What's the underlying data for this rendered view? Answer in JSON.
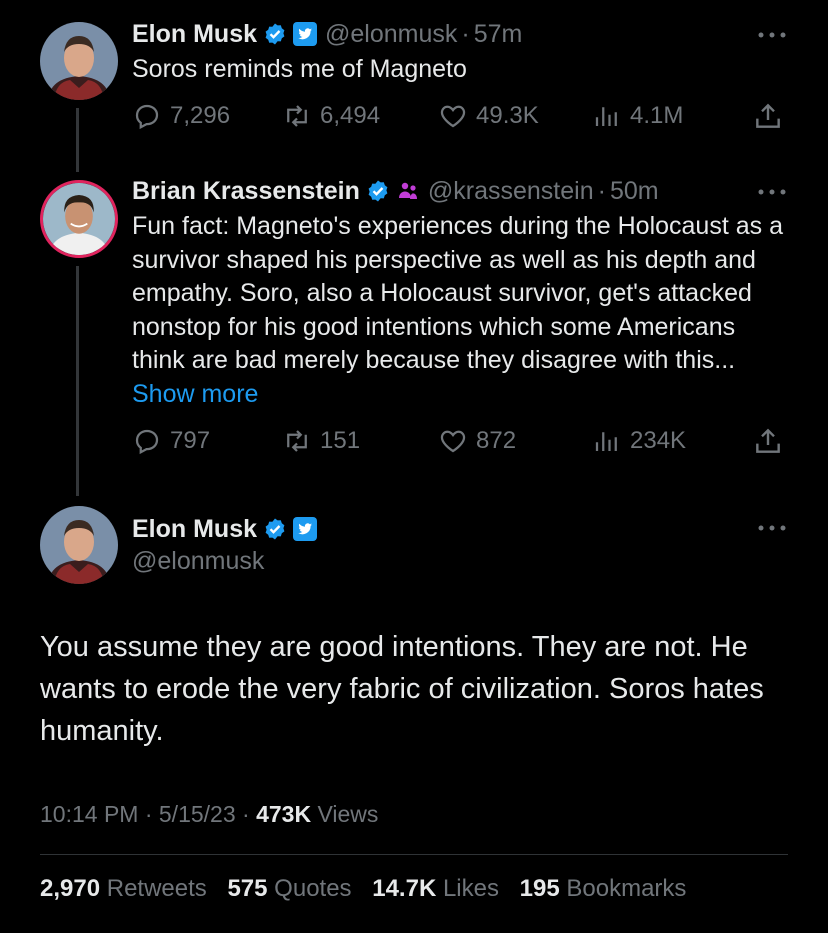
{
  "tweets": [
    {
      "name": "Elon Musk",
      "handle": "@elonmusk",
      "separator": "·",
      "time": "57m",
      "text": "Soros reminds me of Magneto",
      "replies": "7,296",
      "retweets": "6,494",
      "likes": "49.3K",
      "views": "4.1M"
    },
    {
      "name": "Brian Krassenstein",
      "handle": "@krassenstein",
      "separator": "·",
      "time": "50m",
      "text": "Fun fact:  Magneto's experiences during the Holocaust as a survivor shaped his perspective as well as his depth and empathy.  Soro, also a Holocaust survivor, get's attacked nonstop for his good intentions which some Americans think are bad merely because they disagree with this...",
      "show_more": "Show more",
      "replies": "797",
      "retweets": "151",
      "likes": "872",
      "views": "234K"
    }
  ],
  "main": {
    "name": "Elon Musk",
    "handle": "@elonmusk",
    "text": "You assume they are good intentions. They are not. He wants to erode the very fabric of civilization. Soros hates humanity.",
    "timestamp": "10:14 PM · 5/15/23 ·",
    "views_count": "473K",
    "views_label": "Views",
    "retweets_count": "2,970",
    "retweets_label": "Retweets",
    "quotes_count": "575",
    "quotes_label": "Quotes",
    "likes_count": "14.7K",
    "likes_label": "Likes",
    "bookmarks_count": "195",
    "bookmarks_label": "Bookmarks"
  },
  "colors": {
    "background": "#000000",
    "text": "#e7e9ea",
    "muted": "#71767b",
    "link": "#1d9bf0",
    "verified": "#1d9bf0",
    "affiliate": "#c13dd6"
  },
  "icons": {
    "reply": "reply-icon",
    "retweet": "retweet-icon",
    "like": "heart-icon",
    "views": "views-icon",
    "share": "share-icon",
    "more": "more-icon",
    "verified": "verified-badge-icon",
    "twitter": "twitter-affiliate-icon"
  }
}
